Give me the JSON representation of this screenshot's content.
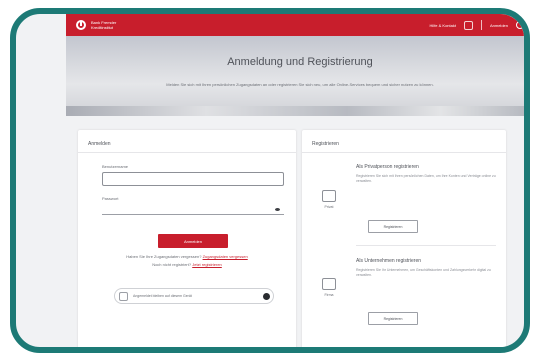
{
  "header": {
    "brand_line1": "Bank Fremder",
    "brand_line2": "Kreditinstitut",
    "link1": "Hilfe & Kontakt",
    "link2": "Anmelden",
    "accent": "#c81e2c"
  },
  "hero": {
    "title": "Anmeldung und Registrierung",
    "description": "Melden Sie sich mit Ihren persönlichen Zugangsdaten an oder registrieren Sie sich neu, um alle Online-Services bequem und sicher nutzen zu können."
  },
  "login": {
    "title": "Anmelden",
    "username_label": "Benutzername",
    "password_label": "Passwort",
    "submit_label": "Anmelden",
    "forgot_text": "Haben Sie Ihre Zugangsdaten vergessen?",
    "forgot_link": "Zugangsdaten vergessen",
    "register_text": "Noch nicht registriert?",
    "register_link": "Jetzt registrieren",
    "remember_text": "Angemeldet bleiben auf diesem Gerät"
  },
  "register": {
    "title": "Registrieren",
    "private": {
      "icon_label": "Privat",
      "title": "Als Privatperson registrieren",
      "desc": "Registrieren Sie sich mit Ihren persönlichen Daten, um Ihre Konten und Verträge online zu verwalten.",
      "button": "Registrieren"
    },
    "business": {
      "icon_label": "Firma",
      "title": "Als Unternehmen registrieren",
      "desc": "Registrieren Sie Ihr Unternehmen, um Geschäftskonten und Zahlungsverkehr digital zu verwalten.",
      "button": "Registrieren"
    }
  }
}
